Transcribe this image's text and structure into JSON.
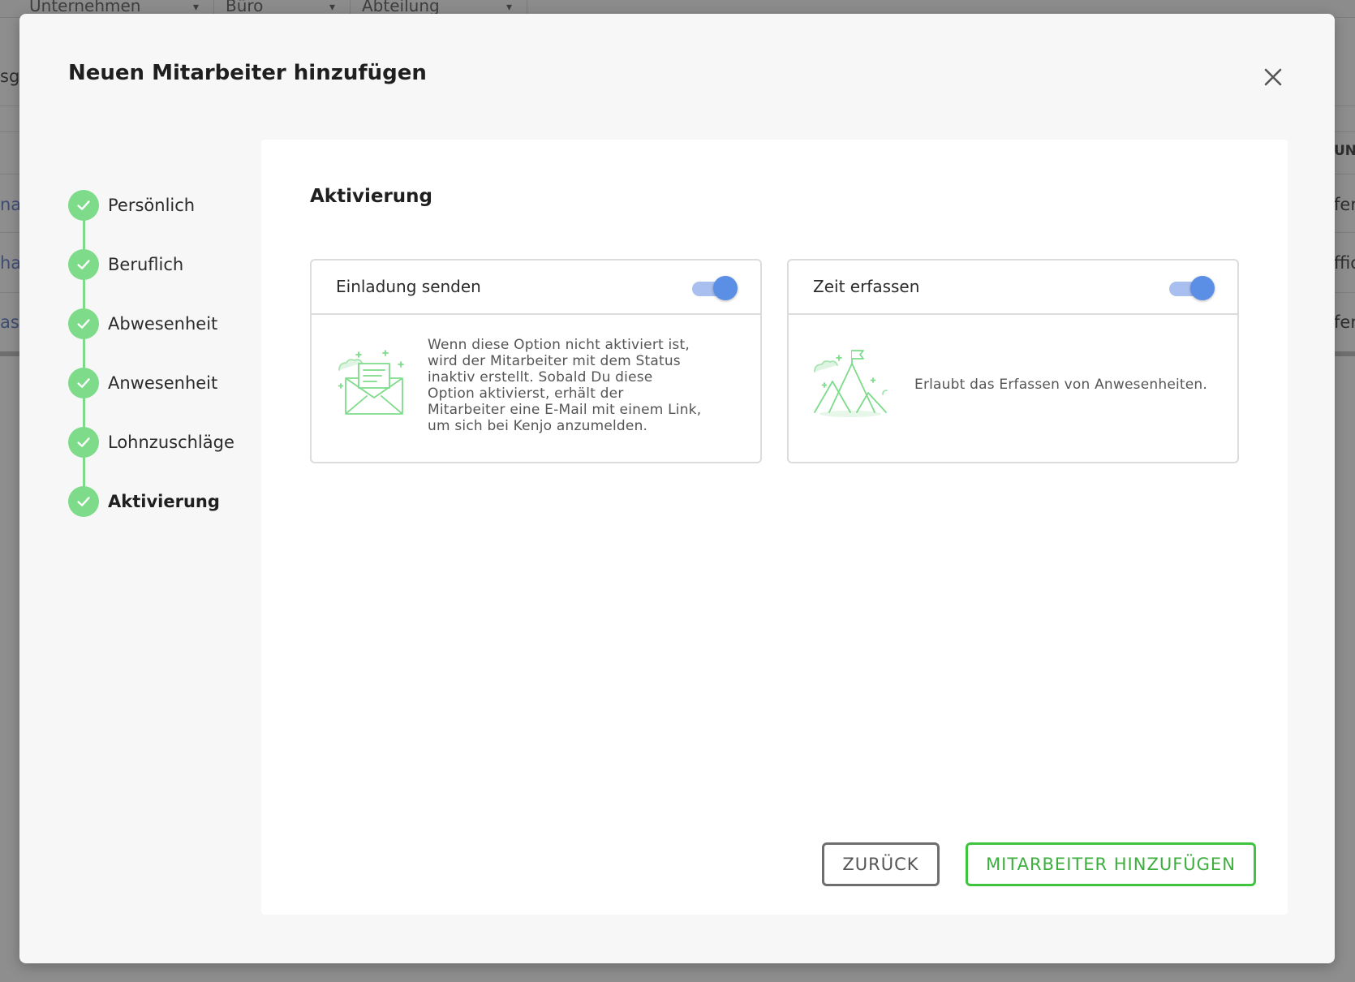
{
  "background": {
    "filters": [
      {
        "label": "Unternehmen"
      },
      {
        "label": "Büro"
      },
      {
        "label": "Abteilung"
      }
    ],
    "left_cells": [
      "sg",
      "nar",
      "hac",
      "ast"
    ],
    "right_cells": [
      "UNG",
      "fer",
      "ffic",
      "fer"
    ]
  },
  "modal": {
    "title": "Neuen Mitarbeiter hinzufügen",
    "close_icon": "close-icon"
  },
  "steps": [
    {
      "label": "Persönlich",
      "status": "done"
    },
    {
      "label": "Beruflich",
      "status": "done"
    },
    {
      "label": "Abwesenheit",
      "status": "done"
    },
    {
      "label": "Anwesenheit",
      "status": "done"
    },
    {
      "label": "Lohnzuschläge",
      "status": "done"
    },
    {
      "label": "Aktivierung",
      "status": "active"
    }
  ],
  "content": {
    "section_title": "Aktivierung",
    "options": [
      {
        "title": "Einladung senden",
        "enabled": true,
        "icon": "envelope-illustration",
        "description": "Wenn diese Option nicht aktiviert ist, wird der Mitarbeiter mit dem Status inaktiv erstellt. Sobald Du diese Option aktivierst, erhält der Mitarbeiter eine E-Mail mit einem Link, um sich bei Kenjo anzumelden."
      },
      {
        "title": "Zeit erfassen",
        "enabled": true,
        "icon": "mountain-flag-illustration",
        "description": "Erlaubt das Erfassen von Anwesenheiten."
      }
    ]
  },
  "footer": {
    "back_label": "ZURÜCK",
    "add_label": "MITARBEITER HINZUFÜGEN"
  },
  "colors": {
    "accent_green": "#3ec43e",
    "step_green": "#7ddb8a",
    "toggle_blue": "#5b8fe6"
  }
}
